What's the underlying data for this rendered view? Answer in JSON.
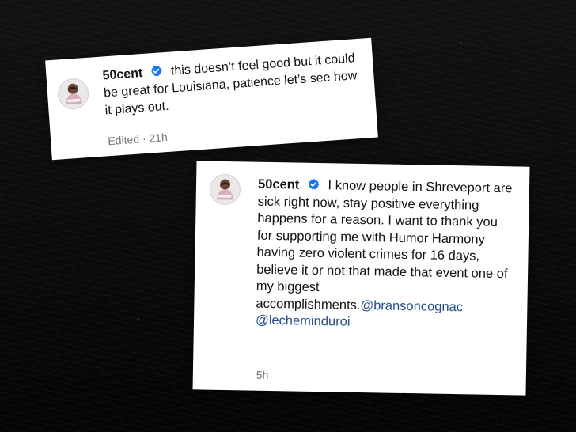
{
  "comments": [
    {
      "username": "50cent",
      "verified_icon": "verified-badge-icon",
      "text": "this doesn’t feel good but it could be great for Louisiana, patience let’s see how it plays out.",
      "meta": "Edited · 21h"
    },
    {
      "username": "50cent",
      "verified_icon": "verified-badge-icon",
      "text": "I know people in Shreveport are sick right now, stay positive everything happens for a reason. I want to thank you for supporting me with Humor Harmony having zero violent crimes for 16 days, believe it or not that made that event one of my biggest accomplishments.",
      "mentions": [
        "@bransoncognac",
        "@lecheminduroi"
      ],
      "meta": "5h"
    }
  ],
  "colors": {
    "background": "#0b0b0c",
    "card": "#ffffff",
    "verified": "#1a77f2",
    "mention": "#234e8e",
    "meta": "#737373"
  }
}
